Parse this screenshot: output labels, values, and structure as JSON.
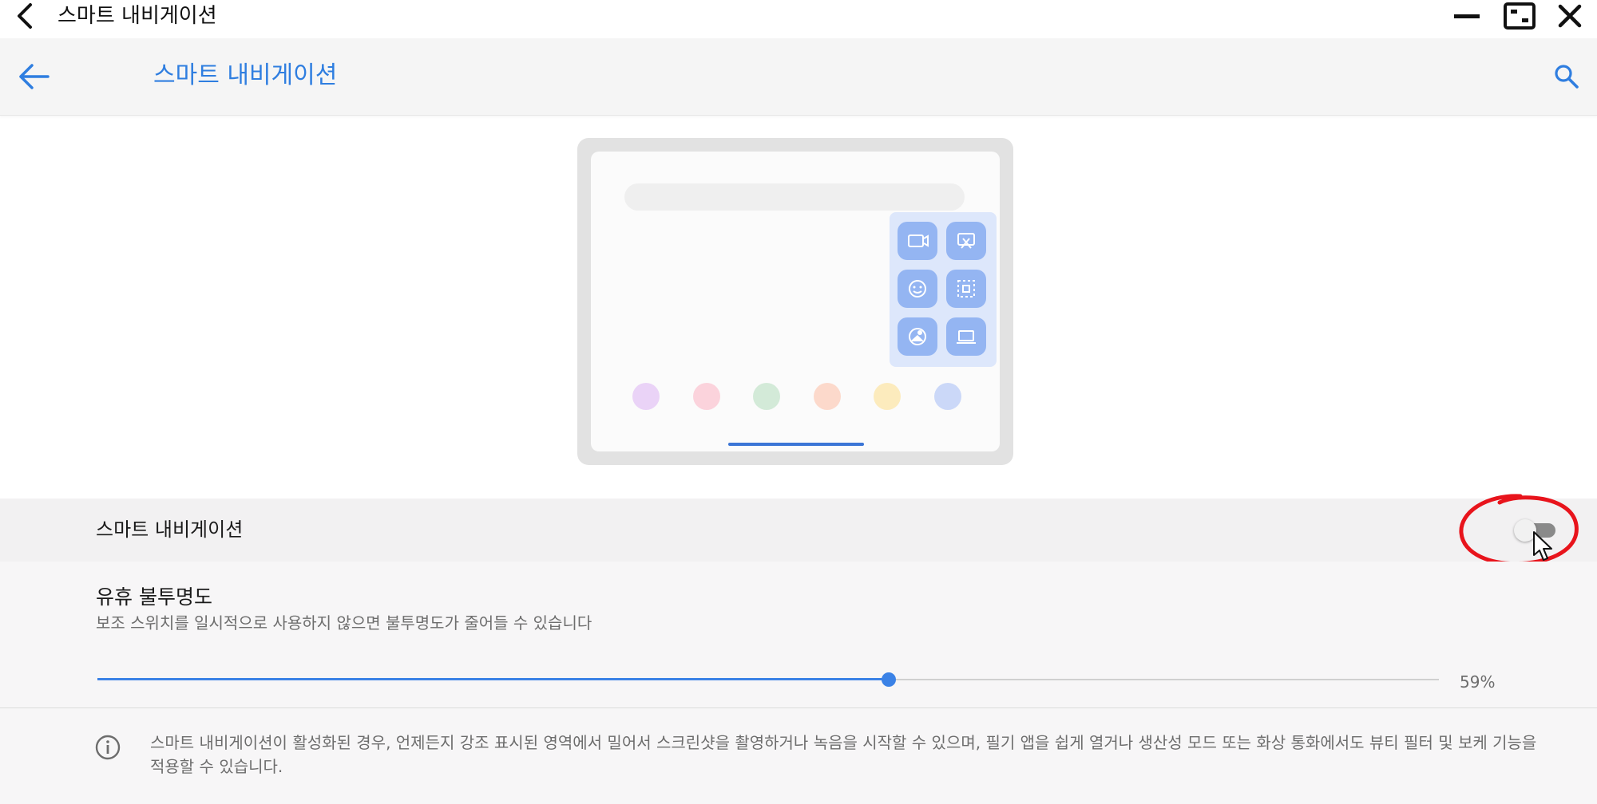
{
  "window": {
    "title": "스마트 내비게이션",
    "back_icon": "chevron-left-icon",
    "minimize_icon": "minimize-icon",
    "restore_icon": "restore-window-icon",
    "close_icon": "close-icon"
  },
  "appbar": {
    "title": "스마트 내비게이션",
    "back_icon": "arrow-left-icon",
    "search_icon": "search-icon",
    "accent_color": "#2f7ee0"
  },
  "illustration": {
    "tool_icons": [
      "screen-record-icon",
      "screenshot-crop-icon",
      "beauty-filter-icon",
      "partial-screenshot-icon",
      "bokeh-icon",
      "laptop-icon"
    ],
    "dock_dot_colors": [
      "#ead3f7",
      "#fbd3dc",
      "#d3ead8",
      "#fcd9cb",
      "#fcebbd",
      "#cbd8f8"
    ]
  },
  "smart_nav": {
    "label": "스마트 내비게이션",
    "enabled": false
  },
  "opacity": {
    "title": "유휴 불투명도",
    "description": "보조 스위치를 일시적으로 사용하지 않으면 불투명도가 줄어들 수 있습니다",
    "value_percent": 59,
    "value_label": "59%"
  },
  "info": {
    "icon": "info-icon",
    "text": "스마트 내비게이션이 활성화된 경우, 언제든지 강조 표시된 영역에서 밀어서 스크린샷을 촬영하거나 녹음을 시작할 수 있으며, 필기 앱을 쉽게 열거나 생산성 모드 또는 화상 통화에서도 뷰티 필터 및 보케 기능을 적용할 수 있습니다."
  },
  "colors": {
    "annotation_circle": "#e8141c",
    "slider_blue": "#3b82e6"
  }
}
